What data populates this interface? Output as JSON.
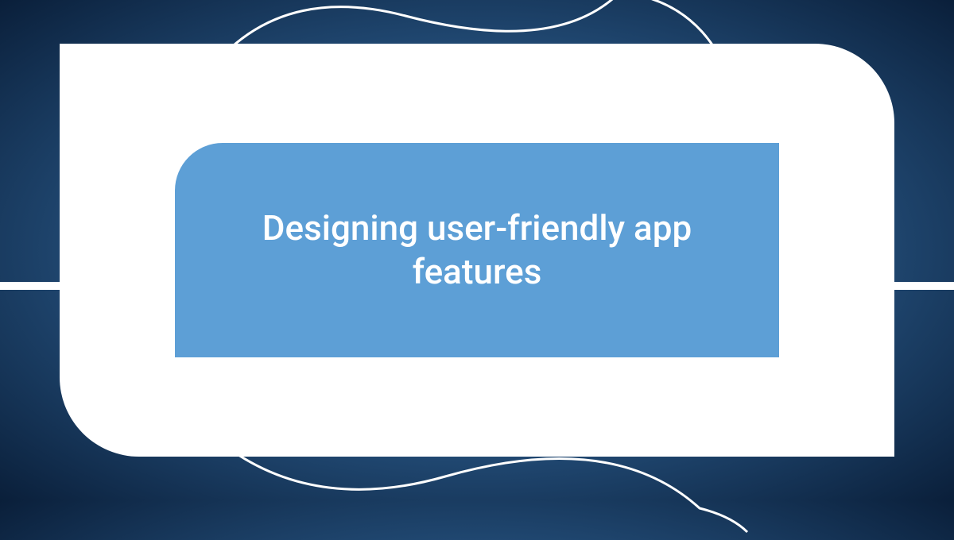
{
  "title": "Designing user-friendly app features"
}
